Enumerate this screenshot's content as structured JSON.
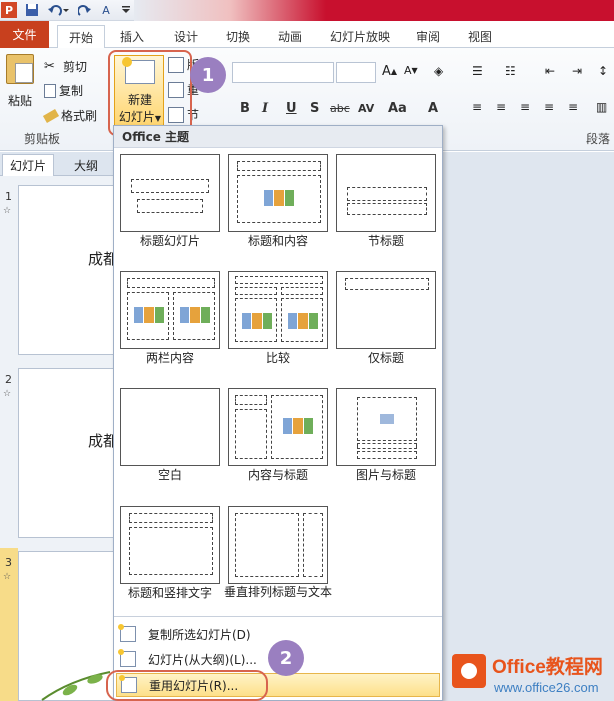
{
  "colors": {
    "file_tab": "#c8401e",
    "accent_red": "#c8102e",
    "annotation": "#d7644e",
    "badge": "#9a7fc0",
    "highlight": "#fde08a",
    "watermark": "#e8541c"
  },
  "qat": {
    "logo": "P",
    "save_icon": "save-icon",
    "undo_icon": "undo-icon",
    "redo_icon": "redo-icon"
  },
  "tabs": {
    "file": "文件",
    "items": [
      "开始",
      "插入",
      "设计",
      "切换",
      "动画",
      "幻灯片放映",
      "审阅",
      "视图"
    ]
  },
  "ribbon": {
    "paste": "粘贴",
    "cut": "剪切",
    "copy": "复制",
    "format_painter": "格式刷",
    "clipboard_group": "剪贴板",
    "new_slide_line1": "新建",
    "new_slide_line2": "幻灯片",
    "layout_partial": "版",
    "reset_partial": "重",
    "section_partial": "节",
    "paragraph_group": "段落",
    "font_buttons": [
      "B",
      "I",
      "U",
      "S",
      "abc",
      "AV",
      "Aa",
      "A"
    ]
  },
  "annotations": {
    "step1": "1",
    "step2": "2"
  },
  "pane": {
    "tab_slides": "幻灯片",
    "tab_outline": "大纲",
    "slides": [
      {
        "number": "1",
        "text": "成都"
      },
      {
        "number": "2",
        "text": "成都"
      },
      {
        "number": "3",
        "text": ""
      }
    ]
  },
  "dropdown": {
    "header": "Office 主题",
    "layouts": [
      "标题幻灯片",
      "标题和内容",
      "节标题",
      "两栏内容",
      "比较",
      "仅标题",
      "空白",
      "内容与标题",
      "图片与标题",
      "标题和竖排文字",
      "垂直排列标题与文本"
    ],
    "menu": [
      "复制所选幻灯片(D)",
      "幻灯片(从大纲)(L)...",
      "重用幻灯片(R)..."
    ]
  },
  "watermark": {
    "title": "Office教程网",
    "url": "www.office26.com"
  }
}
